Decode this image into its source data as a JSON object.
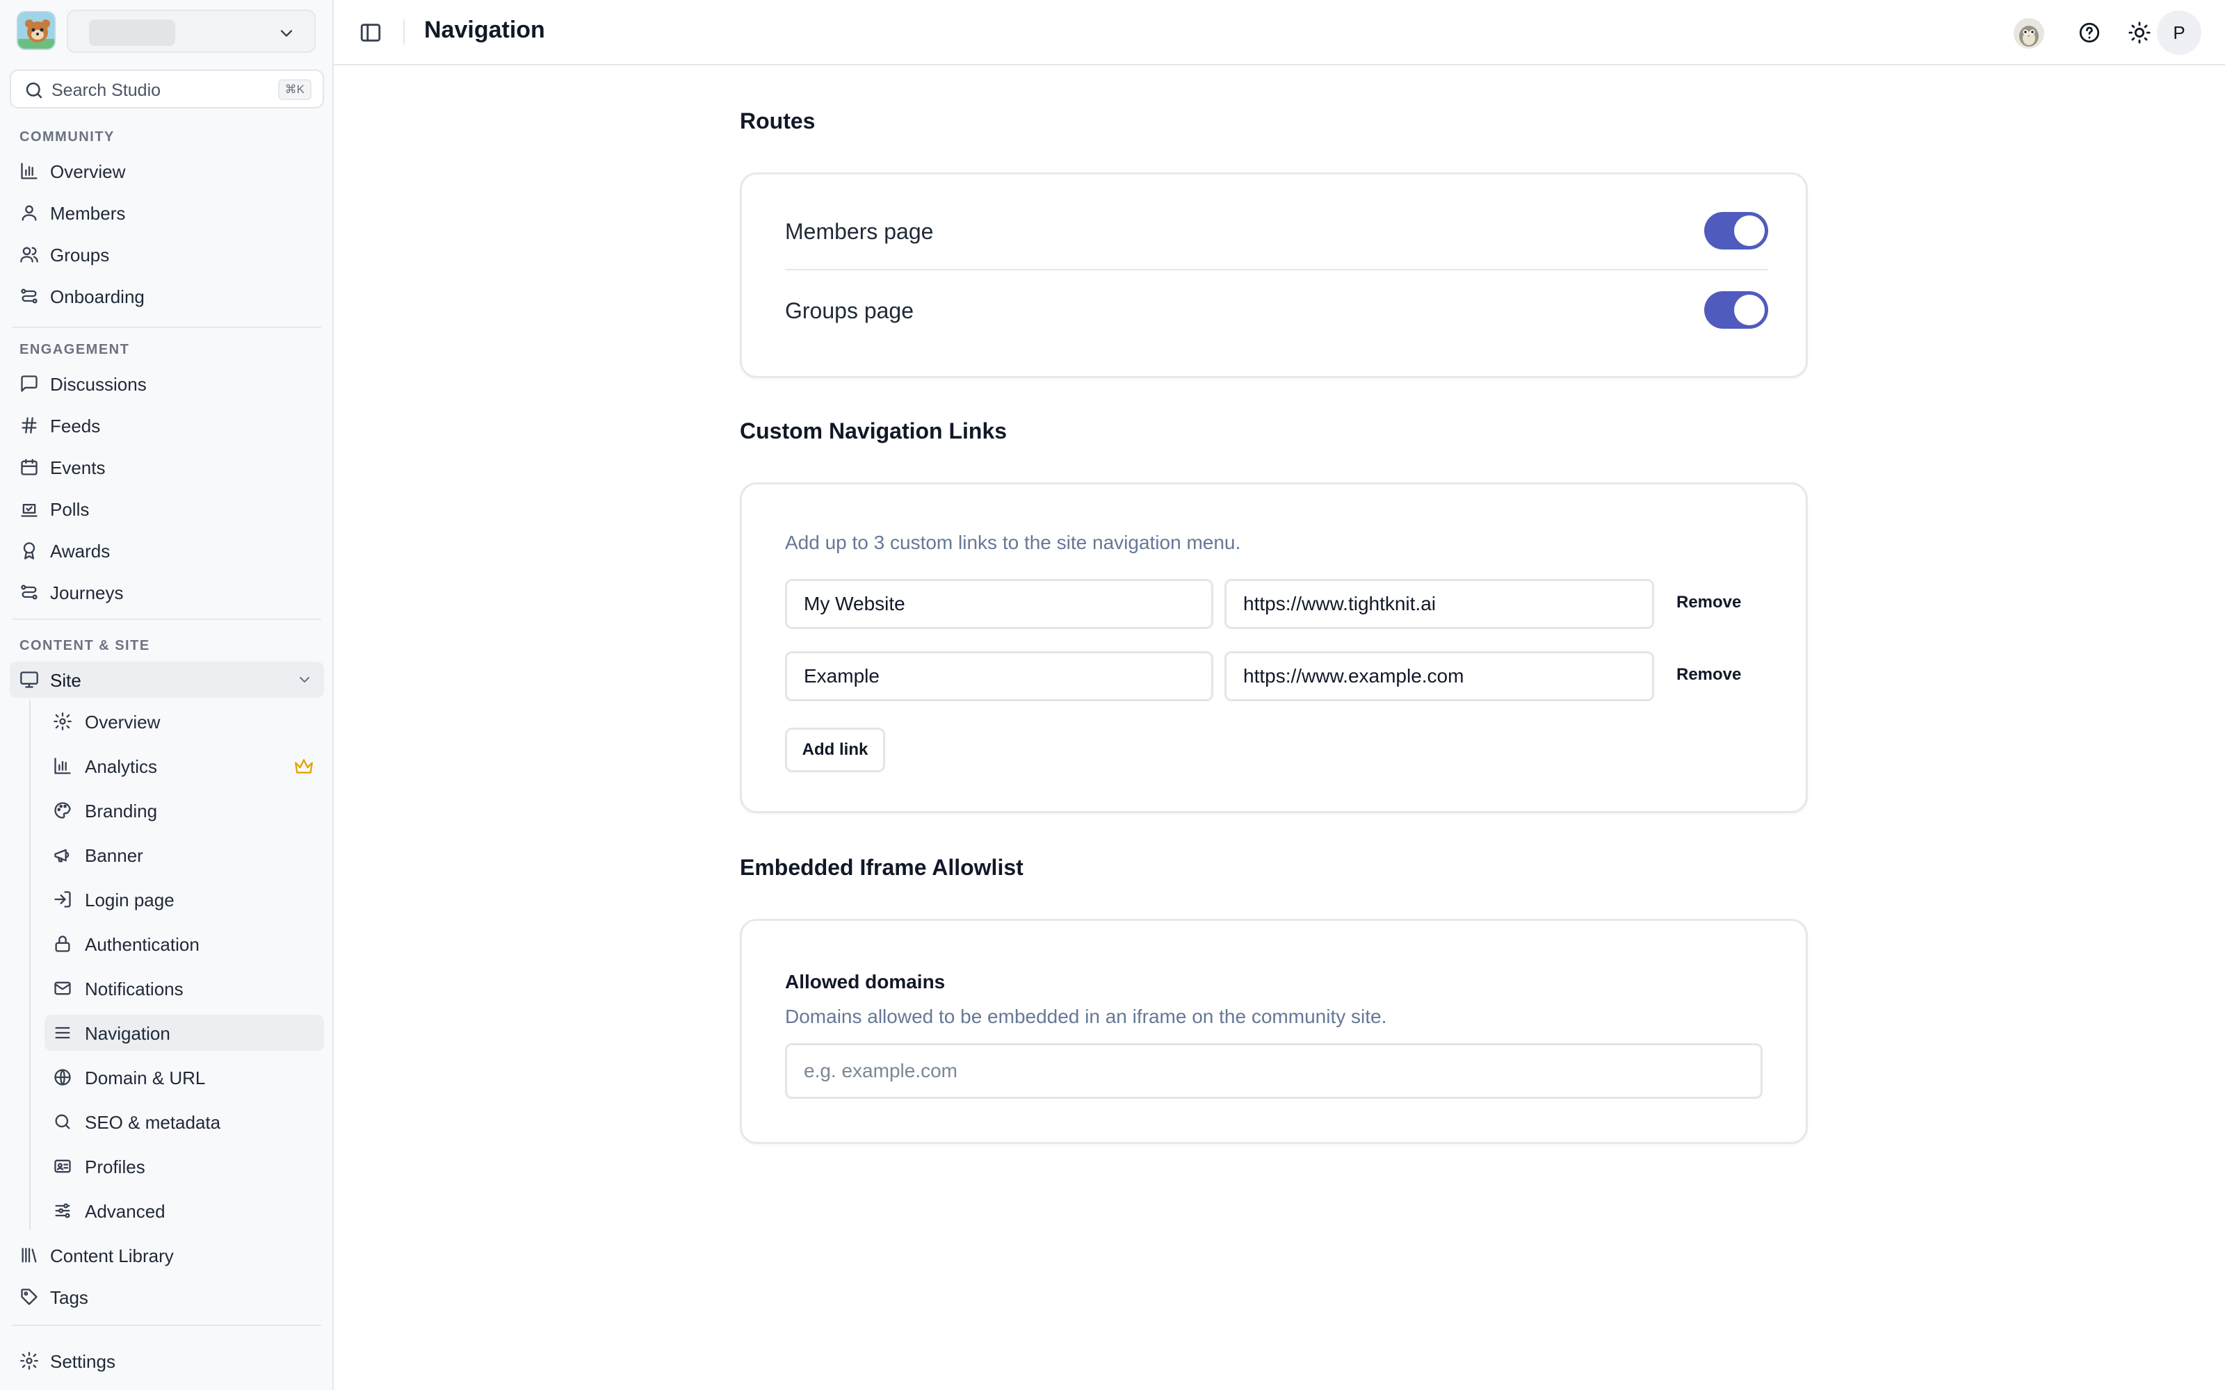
{
  "sidebar": {
    "search_placeholder": "Search Studio",
    "search_shortcut": "⌘K",
    "sections": {
      "community": "COMMUNITY",
      "engagement": "ENGAGEMENT",
      "content_site": "CONTENT & SITE"
    },
    "community_items": [
      "Overview",
      "Members",
      "Groups",
      "Onboarding"
    ],
    "engagement_items": [
      "Discussions",
      "Feeds",
      "Events",
      "Polls",
      "Awards",
      "Journeys"
    ],
    "site_label": "Site",
    "site_items": [
      "Overview",
      "Analytics",
      "Branding",
      "Banner",
      "Login page",
      "Authentication",
      "Notifications",
      "Navigation",
      "Domain & URL",
      "SEO & metadata",
      "Profiles",
      "Advanced"
    ],
    "active_site_item": "Navigation",
    "bottom_items": [
      "Content Library",
      "Tags"
    ],
    "settings_label": "Settings",
    "premium_color": "#e5a400"
  },
  "header": {
    "title": "Navigation",
    "avatar_initial": "P"
  },
  "routes": {
    "heading": "Routes",
    "items": [
      {
        "label": "Members page",
        "enabled": true
      },
      {
        "label": "Groups page",
        "enabled": true
      }
    ],
    "toggle_color": "#4f5bbd"
  },
  "custom_links": {
    "heading": "Custom Navigation Links",
    "description": "Add up to 3 custom links to the site navigation menu.",
    "links": [
      {
        "name": "My Website",
        "url": "https://www.tightknit.ai",
        "remove_label": "Remove"
      },
      {
        "name": "Example",
        "url": "https://www.example.com",
        "remove_label": "Remove"
      }
    ],
    "add_label": "Add link"
  },
  "iframe_allowlist": {
    "heading": "Embedded Iframe Allowlist",
    "field_label": "Allowed domains",
    "field_help": "Domains allowed to be embedded in an iframe on the community site.",
    "placeholder": "e.g. example.com",
    "value": ""
  }
}
